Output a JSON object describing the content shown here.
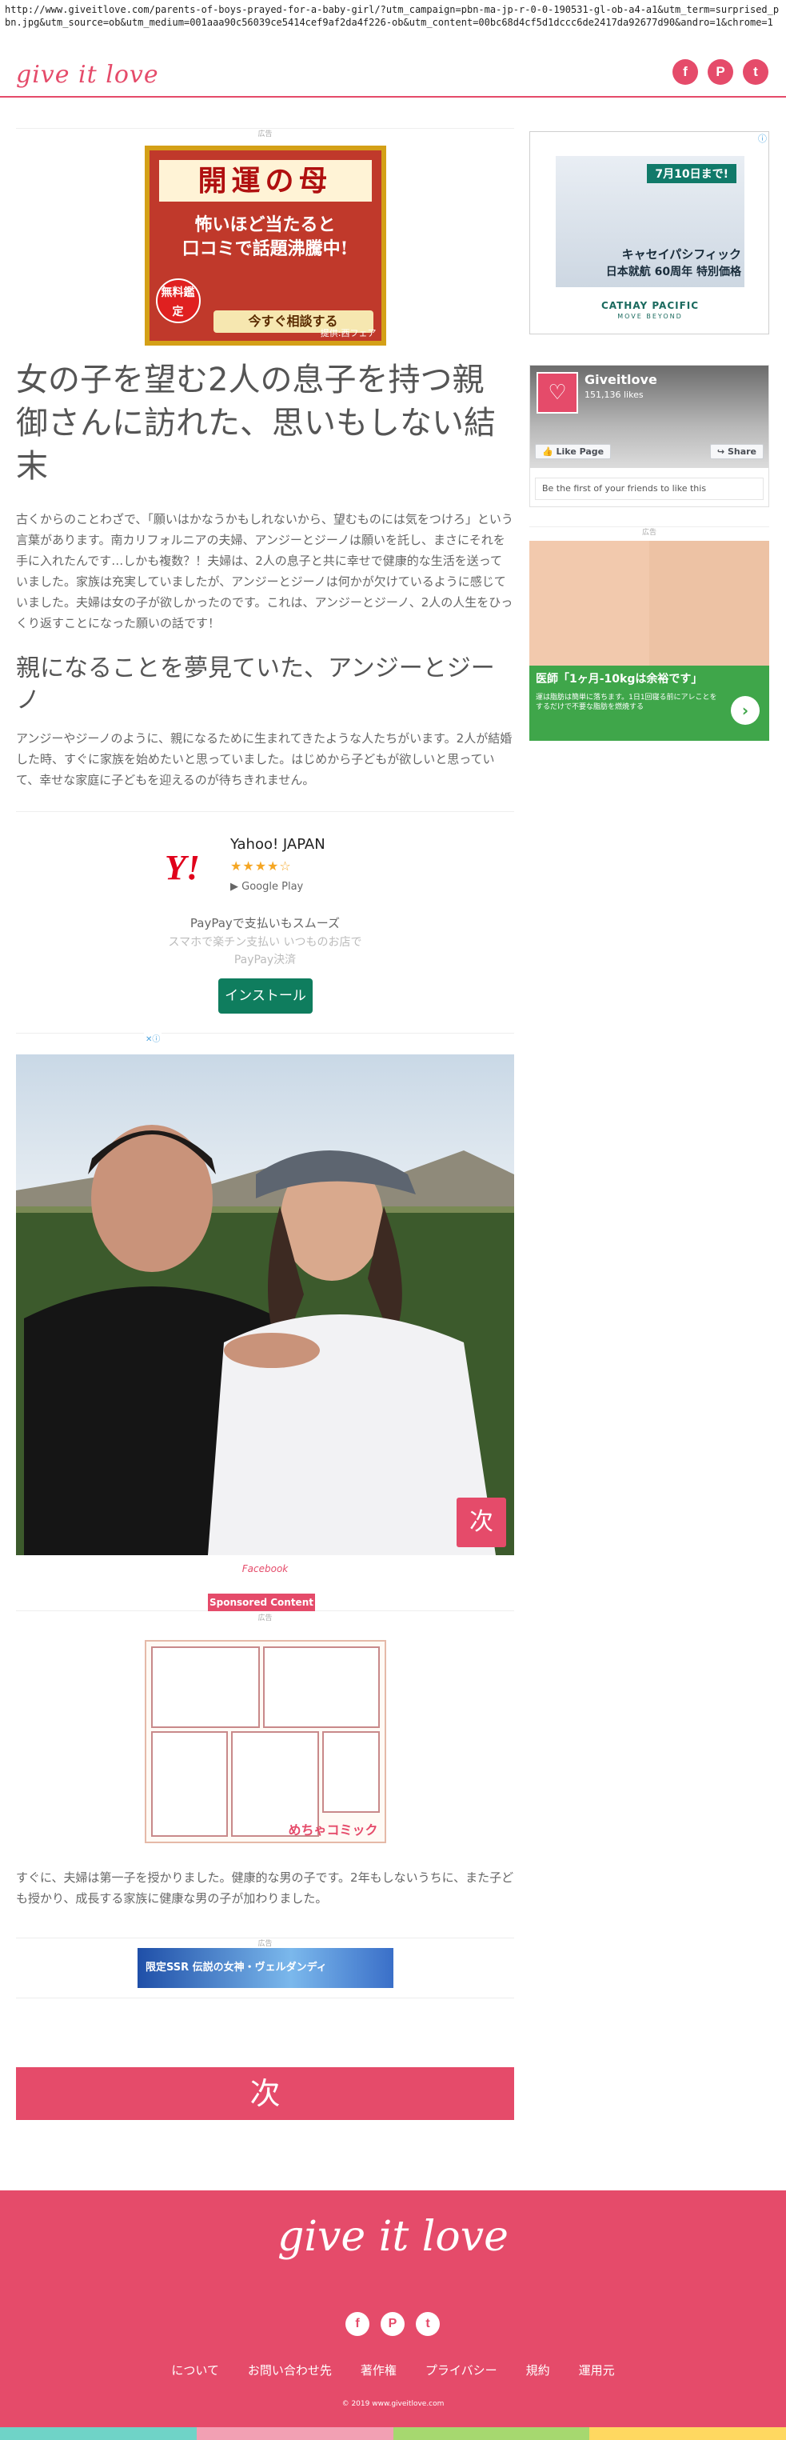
{
  "browser": {
    "url": "http://www.giveitlove.com/parents-of-boys-prayed-for-a-baby-girl/?utm_campaign=pbn-ma-jp-r-0-0-190531-gl-ob-a4-a1&utm_term=surprised_pbn.jpg&utm_source=ob&utm_medium=001aaa90c56039ce5414cef9af2da4f226-ob&utm_content=00bc68d4cf5d1dccc6de2417da92677d90&andro=1&chrome=1"
  },
  "header": {
    "logo": "give it love",
    "social": [
      {
        "icon": "facebook-icon",
        "glyph": "f"
      },
      {
        "icon": "pinterest-icon",
        "glyph": "P"
      },
      {
        "icon": "twitter-icon",
        "glyph": "t"
      }
    ]
  },
  "ads": {
    "label": "広告",
    "fortune": {
      "title": "開運の母",
      "line1": "怖いほど当たると",
      "line2": "口コミで話題沸騰中!",
      "free": "無料鑑定",
      "cta": "今すぐ相談する",
      "provider": "提供:西フェア"
    },
    "app": {
      "logo": "Y!",
      "name": "Yahoo! JAPAN",
      "stars": "★★★★☆",
      "store": "Google Play",
      "desc": "PayPayで支払いもスムーズ",
      "sub": "スマホで楽チン支払い いつものお店で PayPay決済",
      "install": "インストール"
    },
    "promo": {
      "date": "7月10日まで!",
      "line1": "キャセイパシフィック",
      "line2": "日本就航 60周年 特別価格",
      "airline": "CATHAY PACIFIC",
      "tagline": "MOVE BEYOND"
    },
    "beauty": {
      "caption": "医師「1ヶ月-10kgは余裕です」",
      "small": "運は脂肪は簡単に落ちます。1日1回寝る前にアレことをするだけで不要な脂肪を燃焼する",
      "arrow": "›"
    },
    "sponsored": "Sponsored Content",
    "comic_brand": "めちゃコミック",
    "banner": "限定SSR 伝説の女神・ヴェルダンディ"
  },
  "article": {
    "title": "女の子を望む2人の息子を持つ親御さんに訪れた、思いもしない結末",
    "intro": "古くからのことわざで、「願いはかなうかもしれないから、望むものには気をつけろ」という言葉があります。南カリフォルニアの夫婦、アンジーとジーノは願いを託し、まさにそれを手に入れたんです…しかも複数？！夫婦は、2人の息子と共に幸せで健康的な生活を送っていました。家族は充実していましたが、アンジーとジーノは何かが欠けているように感じていました。夫婦は女の子が欲しかったのです。これは、アンジーとジーノ、2人の人生をひっくり返すことになった願いの話です！",
    "heading": "親になることを夢見ていた、アンジーとジーノ",
    "para1": "アンジーやジーノのように、親になるために生まれてきたような人たちがいます。2人が結婚した時、すぐに家族を始めたいと思っていました。はじめから子どもが欲しいと思っていて、幸せな家庭に子どもを迎えるのが待ちきれません。",
    "photo_next": "次",
    "photo_credit": "Facebook",
    "para2": "すぐに、夫婦は第一子を授かりました。健康的な男の子です。2年もしないうちに、また子ども授かり、成長する家族に健康な男の子が加わりました。",
    "next": "次"
  },
  "facebook": {
    "name": "Giveitlove",
    "likes": "151,136 likes",
    "like_btn": "Like Page",
    "share_btn": "Share",
    "friends": "Be the first of your friends to like this"
  },
  "footer": {
    "logo": "give it love",
    "nav": [
      "について",
      "お問い合わせ先",
      "著作権",
      "プライバシー",
      "規約",
      "運用元"
    ],
    "copyright": "© 2019 www.giveitlove.com"
  },
  "colors": {
    "brand": "#e54b6a",
    "bar": [
      "#6fd3c7",
      "#f2a0b3",
      "#a6d86f",
      "#ffd860"
    ]
  }
}
